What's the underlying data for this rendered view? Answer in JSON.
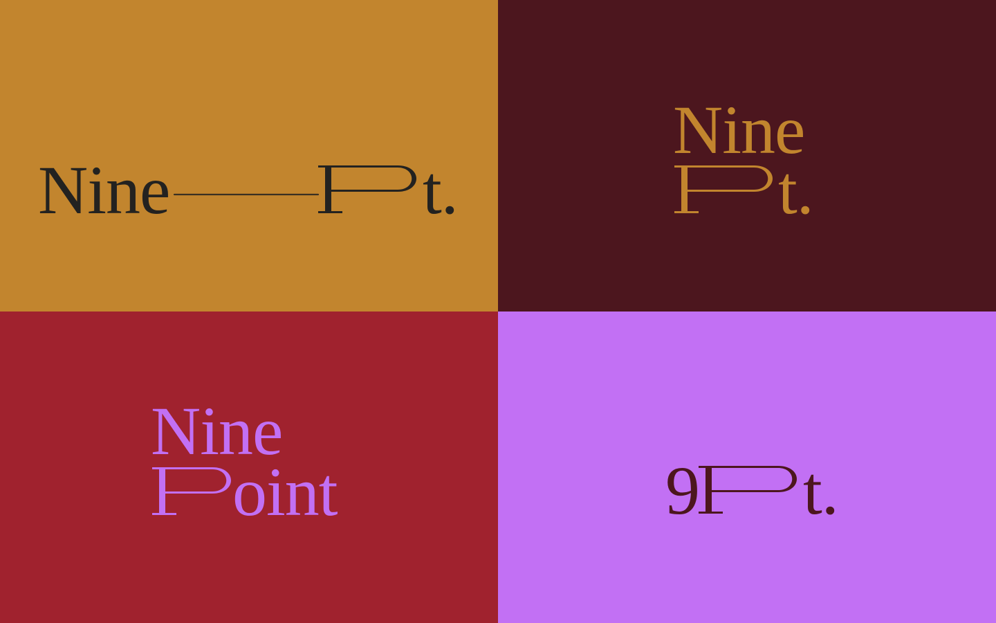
{
  "colors": {
    "ochre": "#C2852E",
    "maroon": "#4C161E",
    "red": "#A0222E",
    "violet": "#C270F4",
    "ink": "#232220"
  },
  "logos": [
    {
      "variant": "horizontal-with-rule",
      "word1": "Nine",
      "p_suffix": "t."
    },
    {
      "variant": "stacked",
      "word1": "Nine",
      "p_suffix": "t."
    },
    {
      "variant": "stacked-full",
      "word1": "Nine",
      "p_suffix": "oint"
    },
    {
      "variant": "numeral",
      "numeral": "9",
      "p_suffix": "t."
    }
  ]
}
